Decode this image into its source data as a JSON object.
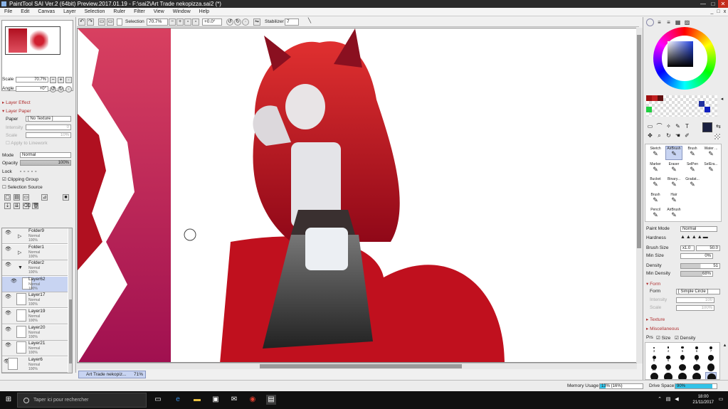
{
  "window": {
    "title": "PaintTool SAI Ver.2 (64bit) Preview.2017.01.19 - F:\\sai2\\Art Trade nekopizza.sai2 (*)",
    "minimize": "—",
    "maximize": "□",
    "close": "✕"
  },
  "menu": [
    "File",
    "Edit",
    "Canvas",
    "Layer",
    "Selection",
    "Ruler",
    "Filter",
    "View",
    "Window",
    "Help"
  ],
  "mdi": {
    "minimize": "_",
    "restore": "□",
    "close": "x"
  },
  "navigator": {
    "scale_label": "Scale",
    "scale_value": "70.7%",
    "angle_label": "Angle",
    "angle_value": "+0°"
  },
  "layer_effect": {
    "title": "Layer Effect"
  },
  "layer_paper": {
    "title": "Layer Paper",
    "paper_label": "Paper",
    "paper_value": "[ No Texture ]",
    "intensity_label": "Intensity",
    "intensity_value": "0",
    "scale_label": "Scale",
    "scale_value": "10%",
    "apply_label": "Apply to Linework"
  },
  "layer_props": {
    "mode_label": "Mode",
    "mode_value": "Normal",
    "opacity_label": "Opacity",
    "opacity_value": "100%",
    "lock_label": "Lock",
    "clipping_label": "Clipping Group",
    "selsource_label": "Selection Source"
  },
  "layers": [
    {
      "name": "Folder9",
      "mode": "Normal",
      "opacity": "100%"
    },
    {
      "name": "Folder1",
      "mode": "Normal",
      "opacity": "100%"
    },
    {
      "name": "Folder2",
      "mode": "Normal",
      "opacity": "100%"
    },
    {
      "name": "Layer62",
      "mode": "Normal",
      "opacity": "100%"
    },
    {
      "name": "Layer17",
      "mode": "Normal",
      "opacity": "100%"
    },
    {
      "name": "Layer19",
      "mode": "Normal",
      "opacity": "100%"
    },
    {
      "name": "Layer20",
      "mode": "Normal",
      "opacity": "100%"
    },
    {
      "name": "Layer21",
      "mode": "Normal",
      "opacity": "100%"
    },
    {
      "name": "Layer6",
      "mode": "Normal",
      "opacity": "100%"
    },
    {
      "name": "Layer5",
      "mode": "Normal",
      "opacity": "100%"
    }
  ],
  "toolbar": {
    "selection_label": "Selection",
    "zoom_value": "70.7%",
    "angle_value": "+0.0°",
    "stabilizer_label": "Stabilizer",
    "stabilizer_value": "7"
  },
  "document_tab": {
    "name": "Art Trade nekopiz...",
    "percent": "71%"
  },
  "brush_tools": [
    {
      "name": "Sketch"
    },
    {
      "name": "AirBrush"
    },
    {
      "name": "Brush"
    },
    {
      "name": "Water ..."
    },
    {
      "name": "Marker"
    },
    {
      "name": "Eraser"
    },
    {
      "name": "SelPen"
    },
    {
      "name": "SelEra..."
    },
    {
      "name": "Bucket"
    },
    {
      "name": "Binary..."
    },
    {
      "name": "Gradat..."
    },
    {
      "name": ""
    },
    {
      "name": "Brush"
    },
    {
      "name": "Hair"
    },
    {
      "name": ""
    },
    {
      "name": ""
    },
    {
      "name": "Pencil"
    },
    {
      "name": "AirBrush"
    },
    {
      "name": ""
    },
    {
      "name": ""
    }
  ],
  "brush_settings": {
    "paint_mode_label": "Paint Mode",
    "paint_mode_value": "Normal",
    "hardness_label": "Hardness",
    "brush_size_label": "Brush Size",
    "brush_size_mult": "x1.0",
    "brush_size_value": "50.0",
    "min_size_label": "Min Size",
    "min_size_value": "0%",
    "density_label": "Density",
    "density_value": "51",
    "min_density_label": "Min Density",
    "min_density_value": "68%",
    "form_title": "Form",
    "form_label": "Form",
    "form_value": "[ Simple Circle ]",
    "intensity_label": "Intensity",
    "intensity_value": "100",
    "scale_label": "Scale",
    "scale_value": "100%",
    "texture_title": "Texture",
    "misc_title": "Miscellaneous",
    "prs_label": "Prs",
    "size_label": "Size",
    "density_check_label": "Density"
  },
  "brush_sizes": [
    "3",
    "4",
    "5",
    "6",
    "7",
    "5",
    "6",
    "7",
    "8",
    "9",
    "10",
    "12",
    "14",
    "16",
    "20",
    "25",
    "30",
    "35",
    "40",
    "50"
  ],
  "status": {
    "memory_label": "Memory Usage",
    "memory_value": "13% (16%)",
    "memory_fraction": 0.13,
    "drive_label": "Drive Space",
    "drive_value": "90%",
    "drive_fraction": 0.9
  },
  "taskbar": {
    "search_placeholder": "Taper ici pour rechercher",
    "time": "18:00",
    "date": "21/11/2017"
  },
  "colors": {
    "accent": "#33c3e8",
    "selected": "#c8d4f2",
    "current_color": "#1a2040",
    "canvas_pink": "#d03060"
  }
}
